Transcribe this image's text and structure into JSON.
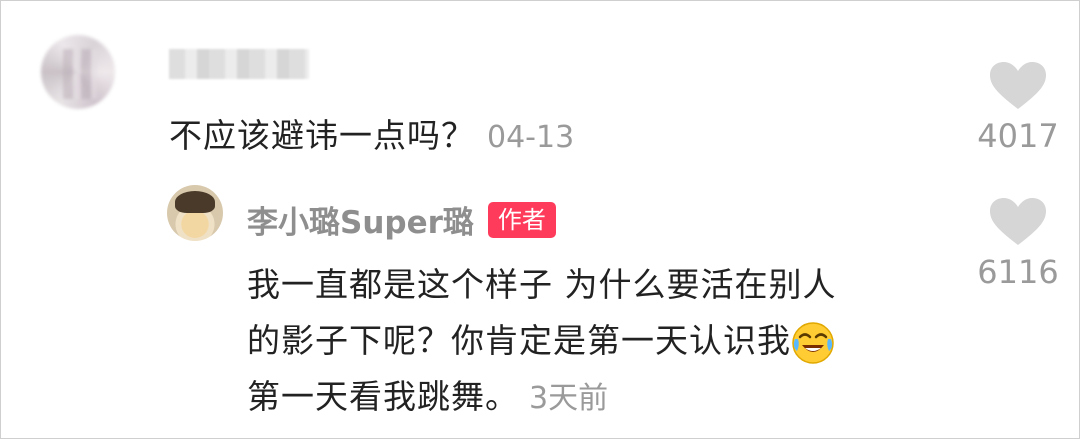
{
  "comment": {
    "text": "不应该避讳一点吗？",
    "date": "04-13",
    "likes": "4017",
    "heart_icon": "heart-icon"
  },
  "reply": {
    "author_name": "李小璐Super璐",
    "author_badge": "作者",
    "text_line1": "我一直都是这个样子 为什么要活在别人",
    "text_line2": "的影子下呢？你肯定是第一天认识我",
    "text_line3": "第一天看我跳舞。",
    "emoji": "crying-laughing-emoji",
    "time": "3天前",
    "likes": "6116"
  },
  "colors": {
    "badge": "#ff3b5c",
    "muted": "#9a9a9a",
    "text": "#222222",
    "heart": "#d6d6d6"
  }
}
